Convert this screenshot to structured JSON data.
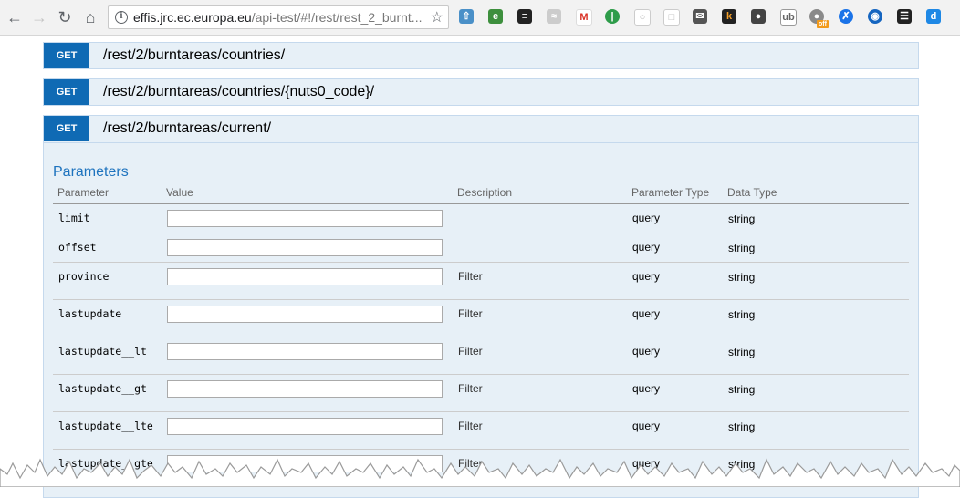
{
  "browser": {
    "url_host": "effis.jrc.ec.europa.eu",
    "url_path": "/api-test/#!/rest/rest_2_burnt...",
    "back_icon": "back-arrow-icon",
    "forward_icon": "forward-arrow-icon",
    "reload_icon": "reload-icon",
    "home_icon": "home-icon",
    "extensions": [
      "upload-arrow-icon",
      "evernote-icon",
      "buffer-icon",
      "rss-icon",
      "gmail-icon",
      "pushbullet-icon",
      "shield-icon",
      "chat-icon",
      "mail-checker-icon",
      "keepa-icon",
      "bulb-icon",
      "ublock-icon",
      "ghostery-icon",
      "link-icon",
      "eye-icon",
      "library-icon",
      "dashlane-icon"
    ],
    "off_badge": "off"
  },
  "operations": [
    {
      "method": "GET",
      "path": "/rest/2/burntareas/countries/"
    },
    {
      "method": "GET",
      "path": "/rest/2/burntareas/countries/{nuts0_code}/"
    },
    {
      "method": "GET",
      "path": "/rest/2/burntareas/current/"
    }
  ],
  "parameters": {
    "title": "Parameters",
    "headers": {
      "parameter": "Parameter",
      "value": "Value",
      "description": "Description",
      "parameter_type": "Parameter Type",
      "data_type": "Data Type"
    },
    "rows": [
      {
        "name": "limit",
        "value": "",
        "description": "",
        "param_type": "query",
        "data_type": "string"
      },
      {
        "name": "offset",
        "value": "",
        "description": "",
        "param_type": "query",
        "data_type": "string"
      },
      {
        "name": "province",
        "value": "",
        "description": "Filter",
        "param_type": "query",
        "data_type": "string"
      },
      {
        "name": "lastupdate",
        "value": "",
        "description": "Filter",
        "param_type": "query",
        "data_type": "string"
      },
      {
        "name": "lastupdate__lt",
        "value": "",
        "description": "Filter",
        "param_type": "query",
        "data_type": "string"
      },
      {
        "name": "lastupdate__gt",
        "value": "",
        "description": "Filter",
        "param_type": "query",
        "data_type": "string"
      },
      {
        "name": "lastupdate__lte",
        "value": "",
        "description": "Filter",
        "param_type": "query",
        "data_type": "string"
      },
      {
        "name": "lastupdate__gte",
        "value": "",
        "description": "Filter",
        "param_type": "query",
        "data_type": "string"
      }
    ]
  },
  "colors": {
    "method_get": "#0f6ab4",
    "section_title": "#1e73be",
    "op_background": "#e7f0f7"
  }
}
